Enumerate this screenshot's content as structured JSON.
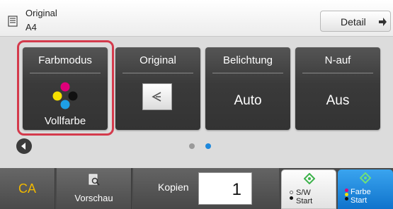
{
  "header": {
    "original_title": "Original",
    "original_size": "A4",
    "detail_label": "Detail",
    "icon": "original-document-icon"
  },
  "modes": [
    {
      "title": "Farbmodus",
      "value": "Vollfarbe",
      "icon": "color-dots-icon"
    },
    {
      "title": "Original",
      "value": "",
      "icon": "original-orientation-icon"
    },
    {
      "title": "Belichtung",
      "value": "Auto"
    },
    {
      "title": "N-auf",
      "value": "Aus"
    }
  ],
  "nav": {
    "left_icon": "arrow-left-icon",
    "pages": 2,
    "active_page": 2
  },
  "bottom": {
    "ca_label": "CA",
    "preview_label": "Vorschau",
    "copies_label": "Kopien",
    "copies_value": "1",
    "sw_line1": "S/W",
    "sw_line2": "Start",
    "color_line1": "Farbe",
    "color_line2": "Start"
  },
  "colors": {
    "highlight": "#d43a4c",
    "ca_text": "#f0b800",
    "color_start": "#1e88dc",
    "start_green": "#3cb24a",
    "page_active": "#1e88dc"
  }
}
